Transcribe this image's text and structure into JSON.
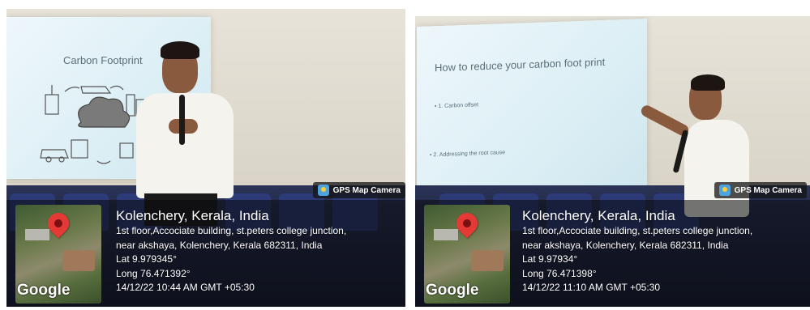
{
  "photos": [
    {
      "slide_title": "Carbon Footprint",
      "slide_bullets": [],
      "badge": "GPS Map Camera",
      "map_logo": "Google",
      "location_title": "Kolenchery, Kerala, India",
      "address_line1": "1st floor,Accociate building, st.peters college junction,",
      "address_line2": "near akshaya, Kolenchery, Kerala 682311, India",
      "lat": "Lat 9.979345°",
      "long": "Long 76.471392°",
      "datetime": "14/12/22 10:44 AM GMT +05:30"
    },
    {
      "slide_title": "How to reduce your carbon foot print",
      "slide_bullets": [
        "• 1. Carbon offset",
        "• 2. Addressing the root cause"
      ],
      "badge": "GPS Map Camera",
      "map_logo": "Google",
      "location_title": "Kolenchery, Kerala, India",
      "address_line1": "1st floor,Accociate building, st.peters college junction,",
      "address_line2": "near akshaya, Kolenchery, Kerala 682311, India",
      "lat": "Lat 9.97934°",
      "long": "Long 76.471398°",
      "datetime": "14/12/22 11:10 AM GMT +05:30"
    }
  ],
  "colors": {
    "pin": "#e53935",
    "badge_icon": "#4ca3e0",
    "overlay": "rgba(10,10,12,0.55)"
  },
  "icons": [
    "map-pin-icon",
    "gps-camera-icon"
  ]
}
